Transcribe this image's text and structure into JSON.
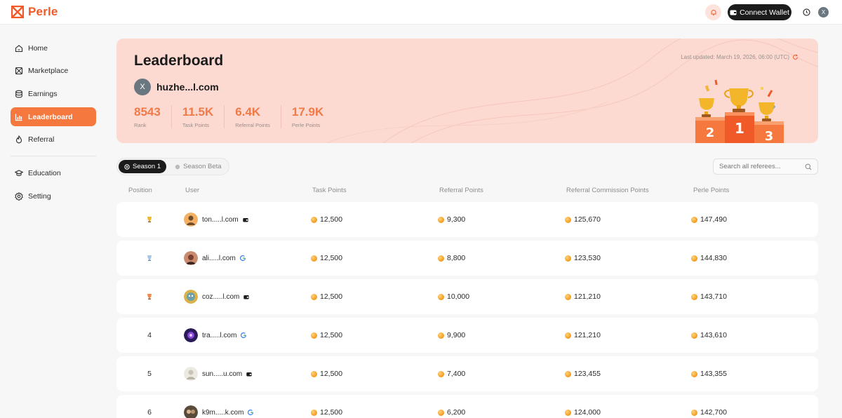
{
  "brand": {
    "name": "Perle",
    "color": "#f05a28"
  },
  "header": {
    "wallet_label": "Connect Wallet",
    "avatar_initial": "X"
  },
  "sidebar": {
    "items": [
      {
        "label": "Home",
        "icon": "home-icon"
      },
      {
        "label": "Marketplace",
        "icon": "marketplace-icon"
      },
      {
        "label": "Earnings",
        "icon": "database-icon"
      },
      {
        "label": "Leaderboard",
        "icon": "chart-icon",
        "active": true
      },
      {
        "label": "Referral",
        "icon": "flame-icon"
      },
      {
        "label": "Education",
        "icon": "graduation-cap-icon"
      },
      {
        "label": "Setting",
        "icon": "gear-icon"
      }
    ]
  },
  "hero": {
    "title": "Leaderboard",
    "last_updated": "Last updated: March 19, 2026, 06:00 (UTC)",
    "user_initial": "X",
    "user_name": "huzhe...l.com",
    "stats": [
      {
        "value": "8543",
        "label": "Rank"
      },
      {
        "value": "11.5K",
        "label": "Task Points"
      },
      {
        "value": "6.4K",
        "label": "Referral Points"
      },
      {
        "value": "17.9K",
        "label": "Perle Points"
      }
    ],
    "podium_numbers": [
      "2",
      "1",
      "3"
    ]
  },
  "tabs": [
    {
      "label": "Season 1",
      "active": true
    },
    {
      "label": "Season Beta",
      "active": false
    }
  ],
  "search": {
    "placeholder": "Search all referees..."
  },
  "table": {
    "columns": [
      "Position",
      "User",
      "Task Points",
      "Referral Points",
      "Referral Commission Points",
      "Perle Points"
    ],
    "rows": [
      {
        "position": "",
        "medal": "gold-trophy-icon",
        "user": "ton.....l.com",
        "auth": "wallet-icon",
        "task": "12,500",
        "referral": "9,300",
        "commission": "125,670",
        "perle": "147,490"
      },
      {
        "position": "",
        "medal": "silver-trophy-icon",
        "user": "ali.....l.com",
        "auth": "google-icon",
        "task": "12,500",
        "referral": "8,800",
        "commission": "123,530",
        "perle": "144,830"
      },
      {
        "position": "",
        "medal": "bronze-trophy-icon",
        "user": "coz.....l.com",
        "auth": "wallet-icon",
        "task": "12,500",
        "referral": "10,000",
        "commission": "121,210",
        "perle": "143,710"
      },
      {
        "position": "4",
        "medal": "",
        "user": "tra.....l.com",
        "auth": "google-icon",
        "task": "12,500",
        "referral": "9,900",
        "commission": "121,210",
        "perle": "143,610"
      },
      {
        "position": "5",
        "medal": "",
        "user": "sun.....u.com",
        "auth": "wallet-icon",
        "task": "12,500",
        "referral": "7,400",
        "commission": "123,455",
        "perle": "143,355"
      },
      {
        "position": "6",
        "medal": "",
        "user": "k9m.....k.com",
        "auth": "google-icon",
        "task": "12,500",
        "referral": "6,200",
        "commission": "124,000",
        "perle": "142,700"
      }
    ]
  },
  "colors": {
    "accent": "#f5793f",
    "hero_bg": "#fcdad2",
    "stat": "#f07a48"
  }
}
